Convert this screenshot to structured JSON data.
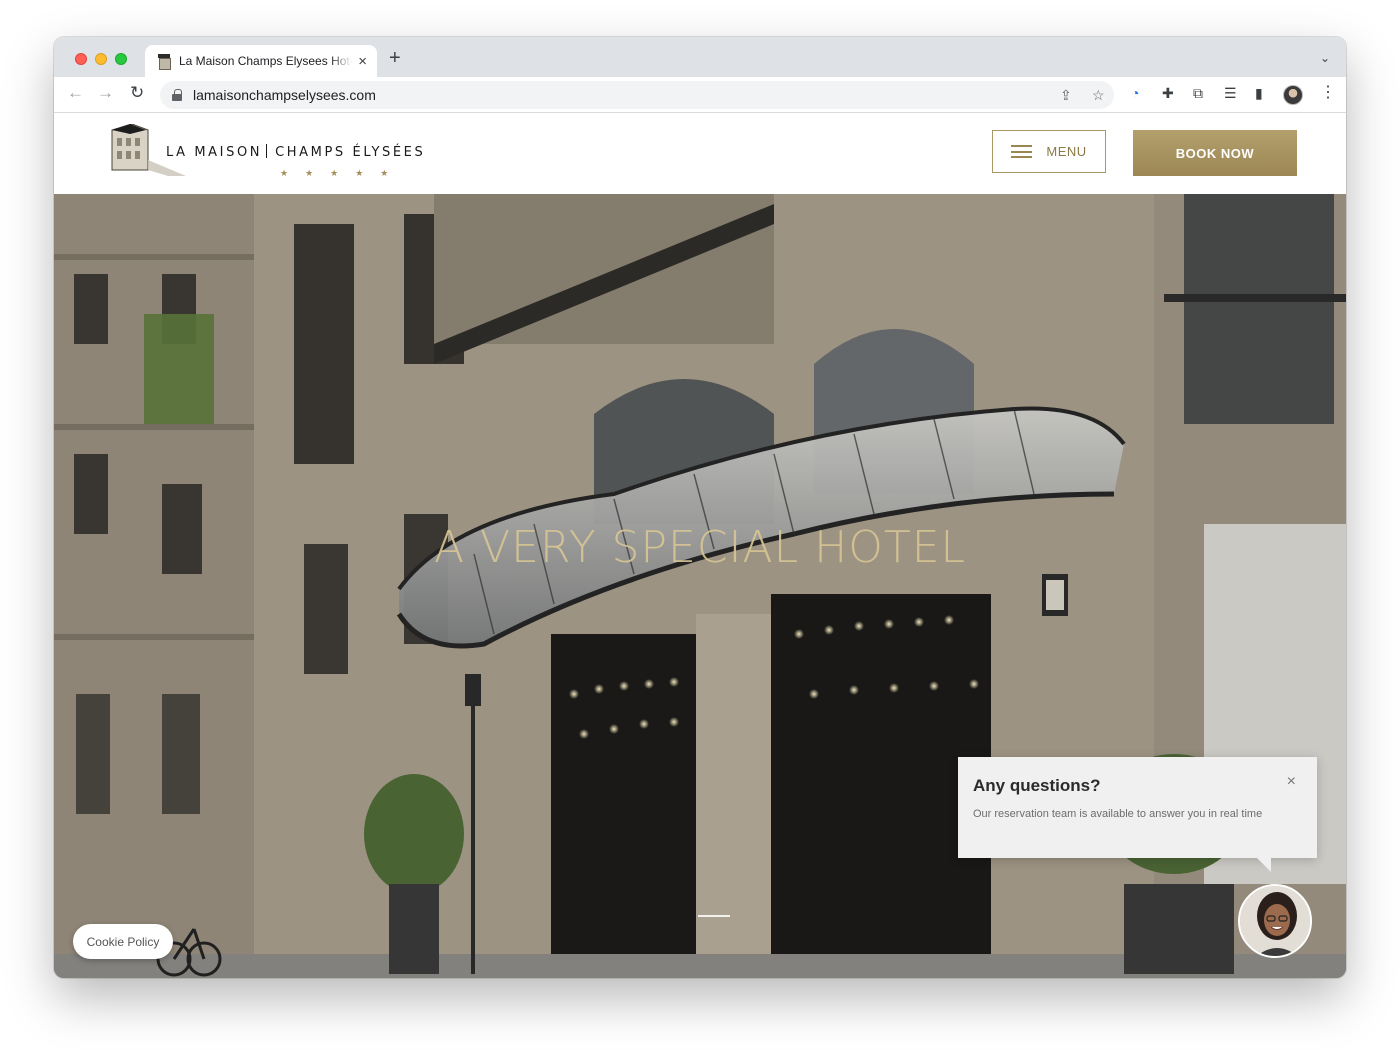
{
  "browser": {
    "tab_title": "La Maison Champs Elysees Hotel",
    "tab_close_icon": "×",
    "new_tab_icon": "+",
    "tab_list_icon": "⌄",
    "url": "lamaisonchampselysees.com",
    "nav": {
      "back": "←",
      "forward": "→",
      "reload": "↻"
    },
    "omnibox_icons": {
      "share": "⇪",
      "bookmark": "☆"
    },
    "toolbar_icons": {
      "extension_a": "◔",
      "extensions": "✚",
      "cast": "⧉",
      "reading_list": "☰",
      "side_panel": "▮",
      "more": "⋮"
    }
  },
  "site": {
    "logo": {
      "left": "LA MAISON",
      "right": "CHAMPS ÉLYSÉES",
      "stars": "★★★★★"
    },
    "menu_label": "MENU",
    "book_label": "BOOK NOW",
    "hero_title": "A VERY SPECIAL HOTEL",
    "cookie_label": "Cookie Policy",
    "chat": {
      "title": "Any questions?",
      "text": "Our reservation team is available to answer you in real time",
      "close_icon": "×"
    }
  },
  "colors": {
    "accent_gold": "#a68e5a",
    "book_button": "#a8945f",
    "hero_title": "#d6c494"
  }
}
